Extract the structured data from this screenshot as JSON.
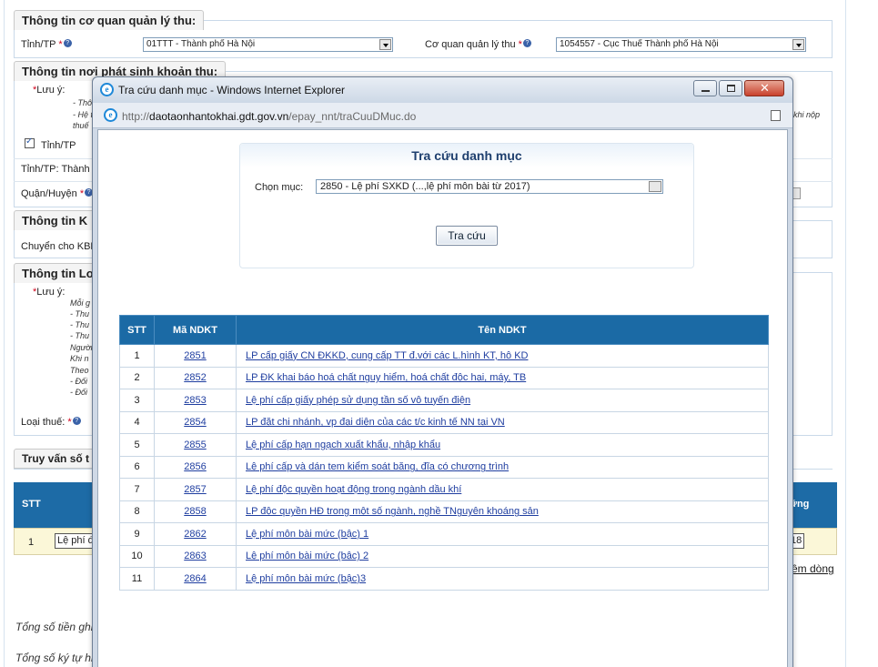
{
  "background": {
    "section1_title": "Thông tin cơ quan quản lý thu:",
    "tinh_label": "Tỉnh/TP",
    "tinh_value": "01TTT - Thành phố Hà Nội",
    "cqql_label": "Cơ quan quản lý thu",
    "cqql_value": "1054557 - Cục Thuế Thành phố Hà Nội",
    "section2_title": "Thông tin nơi phát sinh khoản thu:",
    "luu_y_1": "Lưu ý:",
    "note_a": "- Thô",
    "note_b": "- Hệ t",
    "note_c": "thuế",
    "note_right": "khi nộp",
    "tinh_check_label": "Tỉnh/TP",
    "tinh_tp_label": "Tỉnh/TP:",
    "tinh_tp_value": "Thành",
    "quan_huyen_label": "Quận/Huyện",
    "section3_title": "Thông tin K",
    "chuyen_kbnn": "Chuyển cho KBN",
    "section4_title": "Thông tin Lo",
    "luu_y_2": "Lưu ý:",
    "notes2": [
      "Mỗi g",
      "- Thu",
      "- Thu",
      "- Thu",
      "Người",
      "Khi n",
      "Theo",
      "- Đối",
      "- Đối"
    ],
    "loai_thue_label": "Loại thuế:",
    "truy_van": "Truy vấn số t",
    "stt_head": "STT",
    "right_head": "ững",
    "row_stt": "1",
    "row_value": "Lệ phí đ",
    "row_right": "18",
    "them_dong": "êm dòng",
    "tong_so_tien": "Tổng số tiền ghi",
    "tong_so_ky_tu": "Tổng số ký tự hi"
  },
  "popup": {
    "title": "Tra cứu danh mục - Windows Internet Explorer",
    "url_prefix": "http://",
    "url_host": "daotaonhantokhai.gdt.gov.vn",
    "url_path": "/epay_nnt/traCuuDMuc.do",
    "panel_title": "Tra cứu danh mục",
    "chon_muc_label": "Chọn mục:",
    "chon_muc_value": "2850 - Lệ phí SXKD (...,lệ phí môn bài từ 2017)",
    "search_button": "Tra cứu",
    "columns": [
      "STT",
      "Mã NDKT",
      "Tên NDKT"
    ],
    "rows": [
      {
        "stt": "1",
        "ma": "2851",
        "ten": "LP cấp giấy CN ĐKKD, cung cấp TT đ.với các L.hình KT, hô KD"
      },
      {
        "stt": "2",
        "ma": "2852",
        "ten": "LP ĐK khai báo hoá chất nguy hiểm, hoá chất độc hại, máy, TB"
      },
      {
        "stt": "3",
        "ma": "2853",
        "ten": "Lệ phí cấp giấy phép sử dụng tần số vô tuyến điện"
      },
      {
        "stt": "4",
        "ma": "2854",
        "ten": "LP đặt chi nhánh, vp đại diện của các t/c kinh tế NN tại VN"
      },
      {
        "stt": "5",
        "ma": "2855",
        "ten": "Lệ phí cấp hạn ngạch xuất khẩu, nhập khẩu"
      },
      {
        "stt": "6",
        "ma": "2856",
        "ten": "Lệ phí cấp và dán tem kiểm soát băng, đĩa có chương trình"
      },
      {
        "stt": "7",
        "ma": "2857",
        "ten": "Lệ phí độc quyền hoạt động trong ngành dầu khí"
      },
      {
        "stt": "8",
        "ma": "2858",
        "ten": "LP độc quyền HĐ trong một số ngành, nghề TNguyên khoáng sản"
      },
      {
        "stt": "9",
        "ma": "2862",
        "ten": "Lệ phí môn bài mức (bậc) 1"
      },
      {
        "stt": "10",
        "ma": "2863",
        "ten": "Lệ phí môn bài mức (bậc) 2"
      },
      {
        "stt": "11",
        "ma": "2864",
        "ten": "Lệ phí môn bài mức (bậc)3"
      }
    ]
  },
  "colors": {
    "table_header": "#1b6aa5",
    "link": "#1f3ea0",
    "required": "#d0021b"
  }
}
